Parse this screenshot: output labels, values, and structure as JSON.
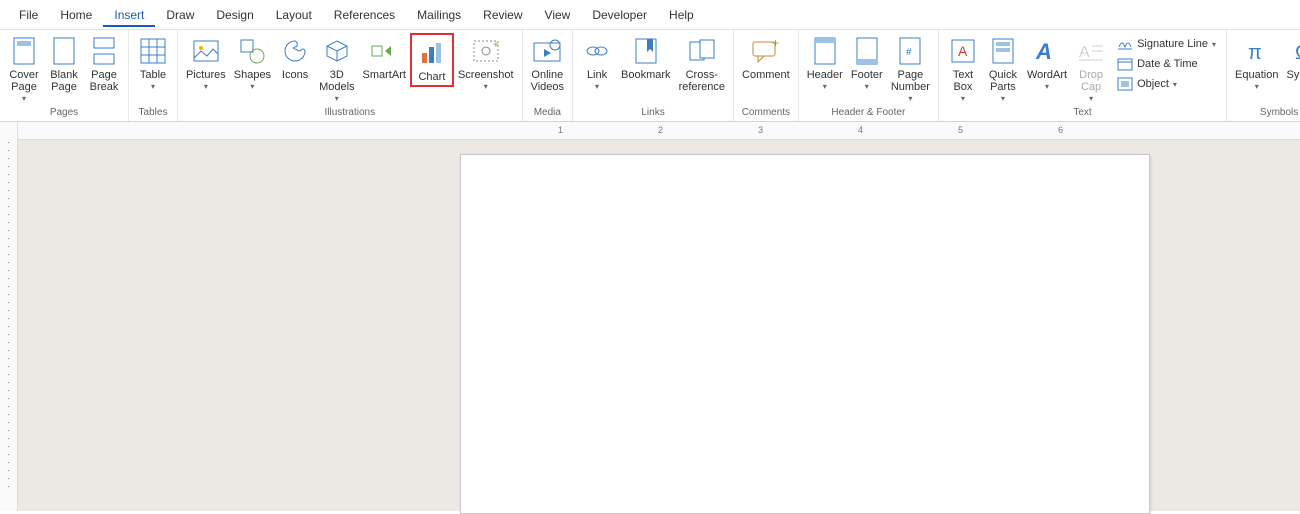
{
  "tabs": {
    "file": "File",
    "home": "Home",
    "insert": "Insert",
    "draw": "Draw",
    "design": "Design",
    "layout": "Layout",
    "references": "References",
    "mailings": "Mailings",
    "review": "Review",
    "view": "View",
    "developer": "Developer",
    "help": "Help"
  },
  "groups": {
    "pages": "Pages",
    "tables": "Tables",
    "illustrations": "Illustrations",
    "media": "Media",
    "links": "Links",
    "comments": "Comments",
    "headerfooter": "Header & Footer",
    "text": "Text",
    "symbols": "Symbols"
  },
  "btn": {
    "cover_page": "Cover\nPage",
    "blank_page": "Blank\nPage",
    "page_break": "Page\nBreak",
    "table": "Table",
    "pictures": "Pictures",
    "shapes": "Shapes",
    "icons": "Icons",
    "models": "3D\nModels",
    "smartart": "SmartArt",
    "chart": "Chart",
    "screenshot": "Screenshot",
    "online_videos": "Online\nVideos",
    "link": "Link",
    "bookmark": "Bookmark",
    "cross_reference": "Cross-\nreference",
    "comment": "Comment",
    "header": "Header",
    "footer": "Footer",
    "page_number": "Page\nNumber",
    "text_box": "Text\nBox",
    "quick_parts": "Quick\nParts",
    "wordart": "WordArt",
    "drop_cap": "Drop\nCap",
    "signature_line": "Signature Line",
    "date_time": "Date & Time",
    "object": "Object",
    "equation": "Equation",
    "symbol": "Symbol"
  },
  "ruler": {
    "marks": [
      "1",
      "2",
      "3",
      "4",
      "5",
      "6"
    ]
  }
}
